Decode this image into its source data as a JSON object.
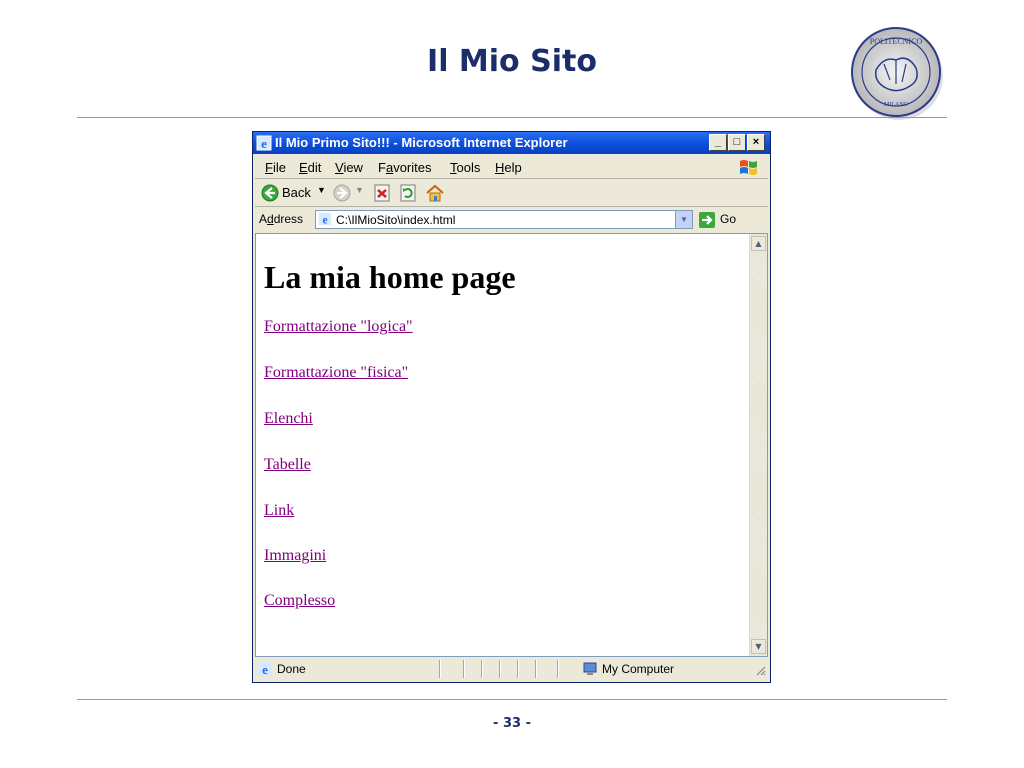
{
  "slide": {
    "title": "Il Mio Sito",
    "page_number": "- 33 -",
    "logo_text_top": "POLITECNICO",
    "logo_text_bottom": "MILANO"
  },
  "window": {
    "title": "Il Mio Primo Sito!!! - Microsoft Internet Explorer",
    "minimize": "_",
    "maximize": "□",
    "close": "×"
  },
  "menu": {
    "items": [
      {
        "accel": "F",
        "rest": "ile"
      },
      {
        "accel": "E",
        "rest": "dit"
      },
      {
        "accel": "V",
        "rest": "iew"
      },
      {
        "pre": "F",
        "accel": "a",
        "rest": "vorites"
      },
      {
        "accel": "T",
        "rest": "ools"
      },
      {
        "accel": "H",
        "rest": "elp"
      }
    ]
  },
  "toolbar": {
    "back_label": "Back"
  },
  "address": {
    "label": "Address",
    "label_accel": "d",
    "value": "C:\\IlMioSito\\index.html",
    "go_label": "Go"
  },
  "page": {
    "heading": "La mia home page",
    "links": [
      "Formattazione \"logica\"",
      "Formattazione \"fisica\"",
      "Elenchi",
      "Tabelle",
      "Link",
      "Immagini",
      "Complesso"
    ]
  },
  "status": {
    "text": "Done",
    "zone": "My Computer"
  },
  "colors": {
    "title_blue": "#1b2e6b",
    "link_visited": "#800080",
    "xp_titlebar": "#0a4cd6"
  }
}
